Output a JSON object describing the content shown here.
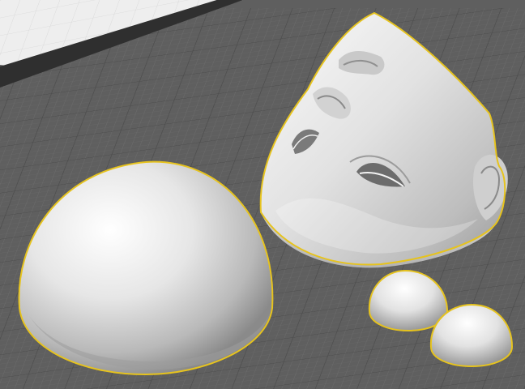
{
  "viewport": {
    "label": "",
    "view": "perspective",
    "colors": {
      "floor": "#5f5f5f",
      "floor_edge": "#2c2c2c",
      "back_plane": "#efefef",
      "grid_minor": "#6c6c6c",
      "grid_major": "#4c4c4c",
      "selection_outline": "#e6c31e",
      "mesh_highlight": "#ffffff",
      "mesh_shadow": "#7b7b7b"
    }
  },
  "objects": [
    {
      "id": "large-dome",
      "kind": "hemisphere",
      "selected": true
    },
    {
      "id": "face-mask",
      "kind": "face-shell",
      "selected": true
    },
    {
      "id": "small-dome-1",
      "kind": "hemisphere",
      "selected": true
    },
    {
      "id": "small-dome-2",
      "kind": "hemisphere",
      "selected": true
    }
  ]
}
